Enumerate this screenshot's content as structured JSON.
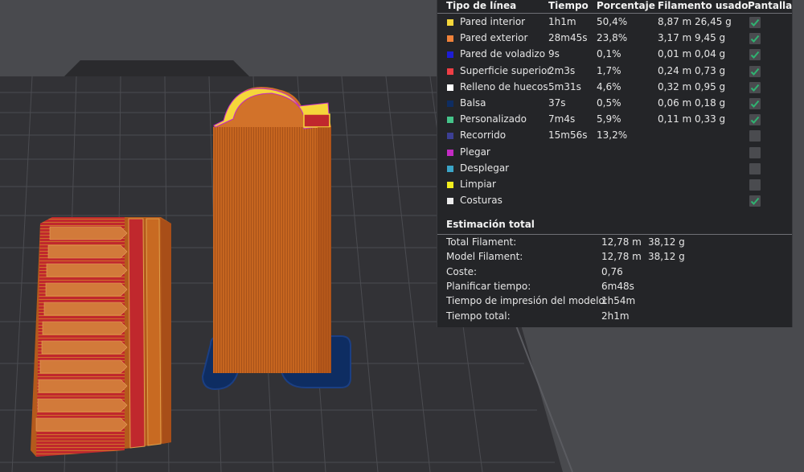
{
  "legend": {
    "headers": {
      "type": "Tipo de línea",
      "time": "Tiempo",
      "percent": "Porcentaje",
      "filament": "Filamento usado",
      "display": "Pantalla"
    },
    "rows": [
      {
        "name": "Pared interior",
        "color": "#f5d63b",
        "time": "1h1m",
        "percent": "50,4%",
        "length": "8,87 m",
        "weight": "26,45 g",
        "checked": true
      },
      {
        "name": "Pared exterior",
        "color": "#f0823a",
        "time": "28m45s",
        "percent": "23,8%",
        "length": "3,17 m",
        "weight": "9,45 g",
        "checked": true
      },
      {
        "name": "Pared de voladizo",
        "color": "#1d1dd6",
        "time": "9s",
        "percent": "0,1%",
        "length": "0,01 m",
        "weight": "0,04 g",
        "checked": true
      },
      {
        "name": "Superficie superior",
        "color": "#ef3e45",
        "time": "2m3s",
        "percent": "1,7%",
        "length": "0,24 m",
        "weight": "0,73 g",
        "checked": true
      },
      {
        "name": "Relleno de huecos",
        "color": "#ffffff",
        "time": "5m31s",
        "percent": "4,6%",
        "length": "0,32 m",
        "weight": "0,95 g",
        "checked": true
      },
      {
        "name": "Balsa",
        "color": "#0e2d62",
        "time": "37s",
        "percent": "0,5%",
        "length": "0,06 m",
        "weight": "0,18 g",
        "checked": true
      },
      {
        "name": "Personalizado",
        "color": "#45c48a",
        "time": "7m4s",
        "percent": "5,9%",
        "length": "0,11 m",
        "weight": "0,33 g",
        "checked": true
      },
      {
        "name": "Recorrido",
        "color": "#3c3f94",
        "time": "15m56s",
        "percent": "13,2%",
        "length": "",
        "weight": "",
        "checked": false
      },
      {
        "name": "Plegar",
        "color": "#c42bc4",
        "time": "",
        "percent": "",
        "length": "",
        "weight": "",
        "checked": false
      },
      {
        "name": "Desplegar",
        "color": "#3ba5c8",
        "time": "",
        "percent": "",
        "length": "",
        "weight": "",
        "checked": false
      },
      {
        "name": "Limpiar",
        "color": "#f2ee1e",
        "time": "",
        "percent": "",
        "length": "",
        "weight": "",
        "checked": false
      },
      {
        "name": "Costuras",
        "color": "#ececec",
        "time": "",
        "percent": "",
        "length": "",
        "weight": "",
        "checked": true
      }
    ]
  },
  "totals": {
    "title": "Estimación total",
    "rows": [
      {
        "label": "Total Filament:",
        "v1": "12,78 m",
        "v2": "38,12 g"
      },
      {
        "label": "Model Filament:",
        "v1": "12,78 m",
        "v2": "38,12 g"
      },
      {
        "label": "Coste:",
        "v1": "0,76",
        "v2": ""
      },
      {
        "label": "Planificar tiempo:",
        "v1": "6m48s",
        "v2": ""
      },
      {
        "label": "Tiempo de impresión del modelo:",
        "v1": "1h54m",
        "v2": ""
      },
      {
        "label": "Tiempo total:",
        "v1": "2h1m",
        "v2": ""
      }
    ]
  },
  "colors": {
    "background": "#494a4e",
    "plate": "#323236",
    "panel": "#242528",
    "model_orange": "#c86a22",
    "raft_blue": "#0e2d62",
    "red_layer": "#c0282d",
    "yellow_wall": "#f5d63b",
    "check_green": "#2fb371"
  },
  "icons": {
    "checkbox": "checkmark-icon"
  }
}
